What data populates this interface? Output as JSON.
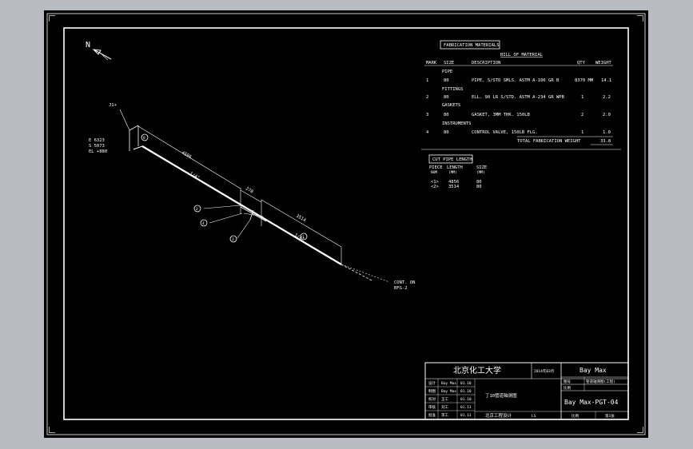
{
  "drawing": {
    "north": "N",
    "iso_labels": {
      "j1": "J1+",
      "coord_e": "E 6323",
      "coord_s": "S 5073",
      "coord_el": "EL +880",
      "dim_upper": "4596",
      "dim_mid": "278",
      "dim_lower": "3514",
      "pipe_upper": "1/4\"",
      "pipe_lower": "1/4\"",
      "cont": "CONT. ON",
      "cont_ref": "BFG-2",
      "num_8": "8",
      "num_2": "2",
      "num_4": "4",
      "num_3": "3",
      "num_1": "1"
    },
    "fab_title": "FABRICATION MATERIALS",
    "bom_title": "BILL OF MATERIAL",
    "bom_headers": [
      "MARK",
      "SIZE",
      "DESCRIPTION",
      "QTY",
      "WEIGHT"
    ],
    "bom_sections": [
      "PIPE",
      "FITTINGS",
      "GASKETS",
      "INSTRUMENTS"
    ],
    "bom_rows": [
      {
        "mark": "1",
        "size": "80",
        "desc": "PIPE, S/STD SMLS. ASTM A-106 GR B",
        "qty": "8370 MM",
        "weight": "14.1"
      },
      {
        "mark": "2",
        "size": "80",
        "desc": "ELL. 90 LR S/STD. ASTM A-234 GR WPB",
        "qty": "1",
        "weight": "2.2"
      },
      {
        "mark": "3",
        "size": "80",
        "desc": "GASKET, 3MM THK. 150LB",
        "qty": "2",
        "weight": "2.0"
      },
      {
        "mark": "4",
        "size": "80",
        "desc": "CONTROL VALVE, 150LB FLG.",
        "qty": "1",
        "weight": "1.0"
      }
    ],
    "total_label": "TOTAL FABRICATION WEIGHT",
    "total_value": "33.8",
    "cut_title": "CUT PIPE LENGTH",
    "cut_headers": [
      "PIECE",
      "LENGTH",
      "SIZE"
    ],
    "cut_subheaders": [
      "NUM",
      "(MM)",
      "(MM)"
    ],
    "cut_rows": [
      {
        "piece": "<1>",
        "length": "4856",
        "size": "80"
      },
      {
        "piece": "<2>",
        "length": "3514",
        "size": "80"
      }
    ]
  },
  "title_block": {
    "school": "北京化工大学",
    "date": "2014年03月",
    "name": "Bay Max",
    "subject_label": "管道轴测图(工程)",
    "code": "Bay Max-PGT-04",
    "desc": "丁10管道轴测图",
    "footer": "北京工程设计",
    "footer_tag": "LS",
    "scale_label": "比例",
    "sheet_label": "第1张",
    "rows": [
      {
        "role": "设计",
        "name": "Bay Max",
        "date": "01.10"
      },
      {
        "role": "制图",
        "name": "Bay Max",
        "date": "01.10"
      },
      {
        "role": "校对",
        "name": "王工",
        "date": "01.10"
      },
      {
        "role": "审核",
        "name": "刘工",
        "date": "01.11"
      },
      {
        "role": "批准",
        "name": "李工",
        "date": "01.11"
      }
    ],
    "small_labels": [
      "图号",
      "比例"
    ]
  }
}
